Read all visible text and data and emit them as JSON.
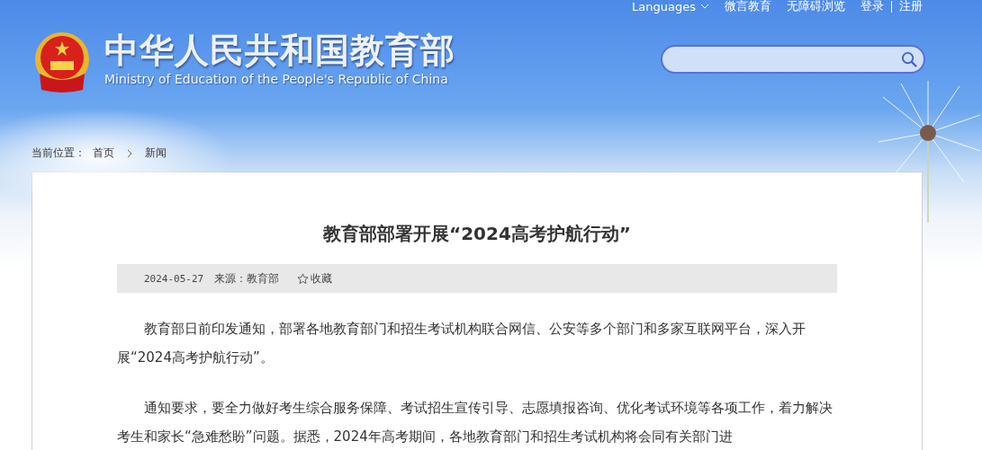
{
  "top_links": [
    {
      "label": "Languages",
      "kind": "dropdown"
    },
    {
      "label": "微言教育",
      "kind": "link"
    },
    {
      "label": "无障碍浏览",
      "kind": "link"
    },
    {
      "label": "登录",
      "kind": "link"
    },
    {
      "label": "注册",
      "kind": "link"
    }
  ],
  "site": {
    "title": "中华人民共和国教育部",
    "subtitle": "Ministry of Education of the People's Republic of China"
  },
  "breadcrumb": {
    "label": "当前位置：",
    "items": [
      "首页",
      "新闻"
    ]
  },
  "article": {
    "title": "教育部部署开展“2024高考护航行动”",
    "date": "2024-05-27",
    "source": "来源：教育部",
    "favorite": "收藏",
    "paragraphs": [
      "教育部日前印发通知，部署各地教育部门和招生考试机构联合网信、公安等多个部门和多家互联网平台，深入开展“2024高考护航行动”。",
      "通知要求，要全力做好考生综合服务保障、考试招生宣传引导、志愿填报咨询、优化考试环境等各项工作，着力解决考生和家长“急难愁盼”问题。据悉，2024年高考期间，各地教育部门和招生考试机构将会同有关部门进"
    ]
  }
}
